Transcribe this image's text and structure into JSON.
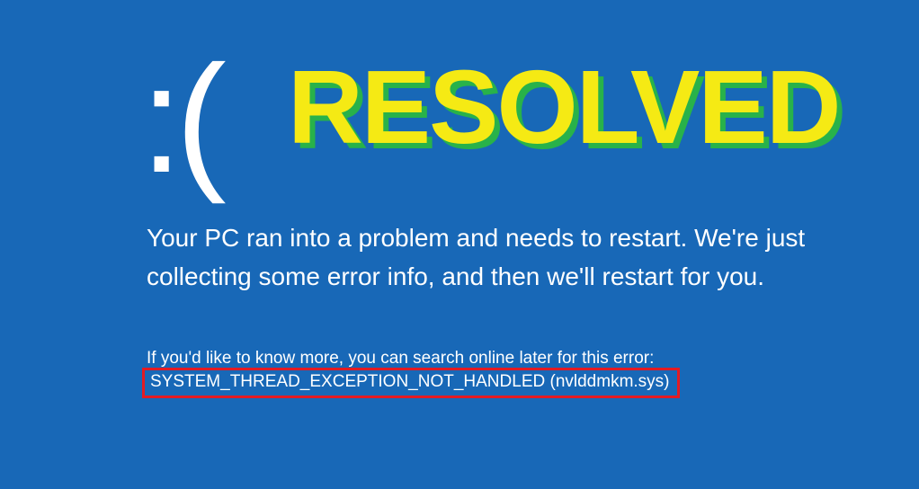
{
  "sad_face": ":(",
  "overlay": {
    "label": "RESOLVED"
  },
  "message": "Your PC ran into a problem and needs to restart. We're just collecting some error info, and then we'll restart for you.",
  "hint": "If you'd like to know more, you can search online later for this error:",
  "error_code": "SYSTEM_THREAD_EXCEPTION_NOT_HANDLED (nvlddmkm.sys)"
}
